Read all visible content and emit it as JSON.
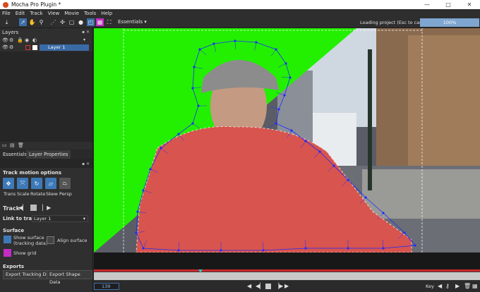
{
  "window": {
    "title": "Mocha Pro Plugin *",
    "controls": [
      "—",
      "□",
      "✕"
    ]
  },
  "menu": [
    "File",
    "Edit",
    "Track",
    "View",
    "Movie",
    "Tools",
    "Help"
  ],
  "toolbar": {
    "workspace": "Essentials",
    "loading_text": "Loading project (Esc to cancel)",
    "progress_label": "100%",
    "progress_value": 1.0
  },
  "layers_panel": {
    "title": "Layers",
    "layers": [
      {
        "name": "Layer 1",
        "selected": true
      }
    ]
  },
  "tabs": [
    {
      "label": "Essentials",
      "active": false
    },
    {
      "label": "Layer Properties",
      "active": true
    }
  ],
  "track_motion": {
    "title": "Track motion options",
    "options": [
      {
        "label": "Trans",
        "icon": "translate-icon",
        "active": true
      },
      {
        "label": "Scale",
        "icon": "scale-icon",
        "active": true
      },
      {
        "label": "Rotate",
        "icon": "rotate-icon",
        "active": true
      },
      {
        "label": "Skew",
        "icon": "skew-icon",
        "active": true
      },
      {
        "label": "Persp",
        "icon": "perspective-icon",
        "active": false
      }
    ]
  },
  "track": {
    "label": "Track"
  },
  "link_to_track": {
    "label": "Link to track",
    "value": "Layer 1"
  },
  "surface": {
    "title": "Surface",
    "show_surface": "Show surface\n(tracking data)",
    "align_surface": "Align surface",
    "show_grid": "Show grid"
  },
  "exports": {
    "title": "Exports",
    "tracking_button": "Export Tracking Data",
    "shape_button": "Export Shape Data"
  },
  "timeline": {
    "frame": "139",
    "key_label": "Key"
  },
  "colors": {
    "accent_blue": "#3d79b8",
    "magenta": "#c32dc3",
    "green_screen": "#22f000",
    "timeline_red": "#c8282e",
    "spline_blue": "#1f2cff"
  }
}
